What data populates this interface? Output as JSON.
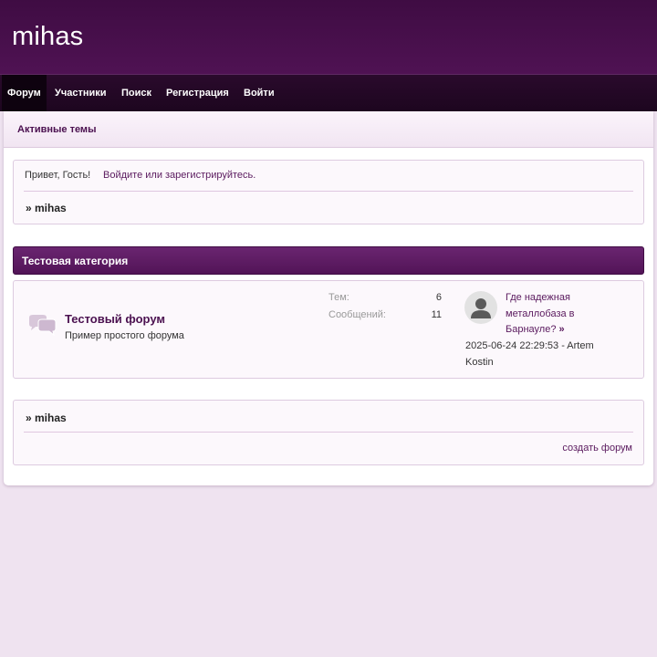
{
  "site": {
    "title": "mihas"
  },
  "nav": {
    "items": [
      {
        "label": "Форум",
        "active": true
      },
      {
        "label": "Участники"
      },
      {
        "label": "Поиск"
      },
      {
        "label": "Регистрация"
      },
      {
        "label": "Войти"
      }
    ]
  },
  "tabs": {
    "active_topics": "Активные темы"
  },
  "welcome": {
    "greeting": "Привет, Гость!",
    "login_link": "Войдите или зарегистрируйтесь.",
    "breadcrumb": "» mihas"
  },
  "category": {
    "title": "Тестовая категория",
    "forum": {
      "name": "Тестовый форум",
      "description": "Пример простого форума",
      "icon": "chat-bubbles-icon",
      "stats": {
        "topics_label": "Тем:",
        "topics_value": "6",
        "posts_label": "Сообщений:",
        "posts_value": "11"
      },
      "last_post": {
        "avatar": "user-avatar-icon",
        "title": "Где надежная металлобаза в Барнауле?",
        "raquo": "»",
        "meta": "2025-06-24 22:29:53 - Artem Kostin"
      }
    }
  },
  "footer_box": {
    "breadcrumb": "» mihas",
    "create_forum": "создать форум"
  },
  "colors": {
    "header_bg": "#4a1050",
    "nav_bg": "#220826",
    "accent": "#5a1a5e",
    "page_bg": "#efe3f0"
  }
}
